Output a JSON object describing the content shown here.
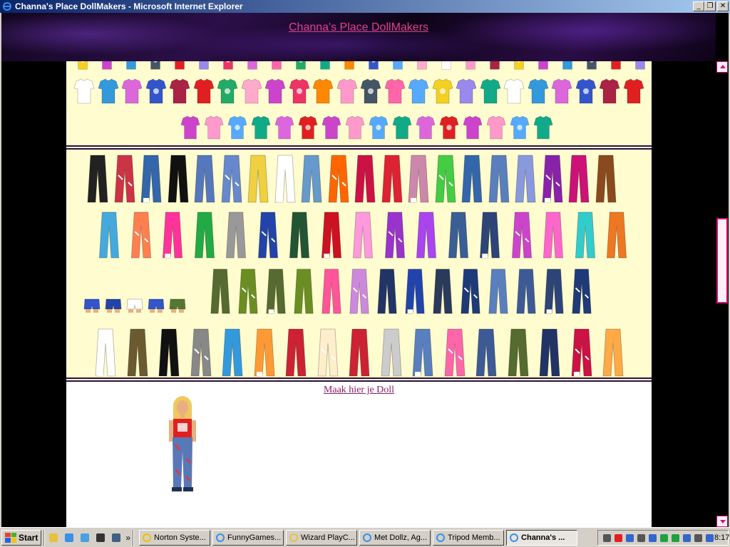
{
  "window": {
    "title": "Channa's Place DollMakers - Microsoft Internet Explorer",
    "buttons": {
      "minimize": "_",
      "maximize": "❐",
      "close": "✕"
    }
  },
  "page": {
    "site_title": "Channa's Place DollMakers",
    "doll_link": "Maak hier je Doll"
  },
  "colors": {
    "content_bg": "#fffcd0",
    "link": "#8a1e6a",
    "banner_link": "#e0408a",
    "accent": "#d01070"
  },
  "taskbar": {
    "start_label": "Start",
    "quicklaunch": [
      "outlook-icon",
      "ie-icon",
      "network-icon",
      "media-icon",
      "desktop-icon"
    ],
    "more": "»",
    "tasks": [
      {
        "label": "Norton Syste...",
        "icon": "norton-icon",
        "active": false
      },
      {
        "label": "FunnyGames...",
        "icon": "ie-icon",
        "active": false
      },
      {
        "label": "Wizard PlayC...",
        "icon": "folder-icon",
        "active": false
      },
      {
        "label": "Met Dollz, Ag...",
        "icon": "ie-icon",
        "active": false
      },
      {
        "label": "Tripod Memb...",
        "icon": "ie-icon",
        "active": false
      },
      {
        "label": "Channa's ...",
        "icon": "ie-icon",
        "active": true
      }
    ],
    "clock": "8:17"
  }
}
